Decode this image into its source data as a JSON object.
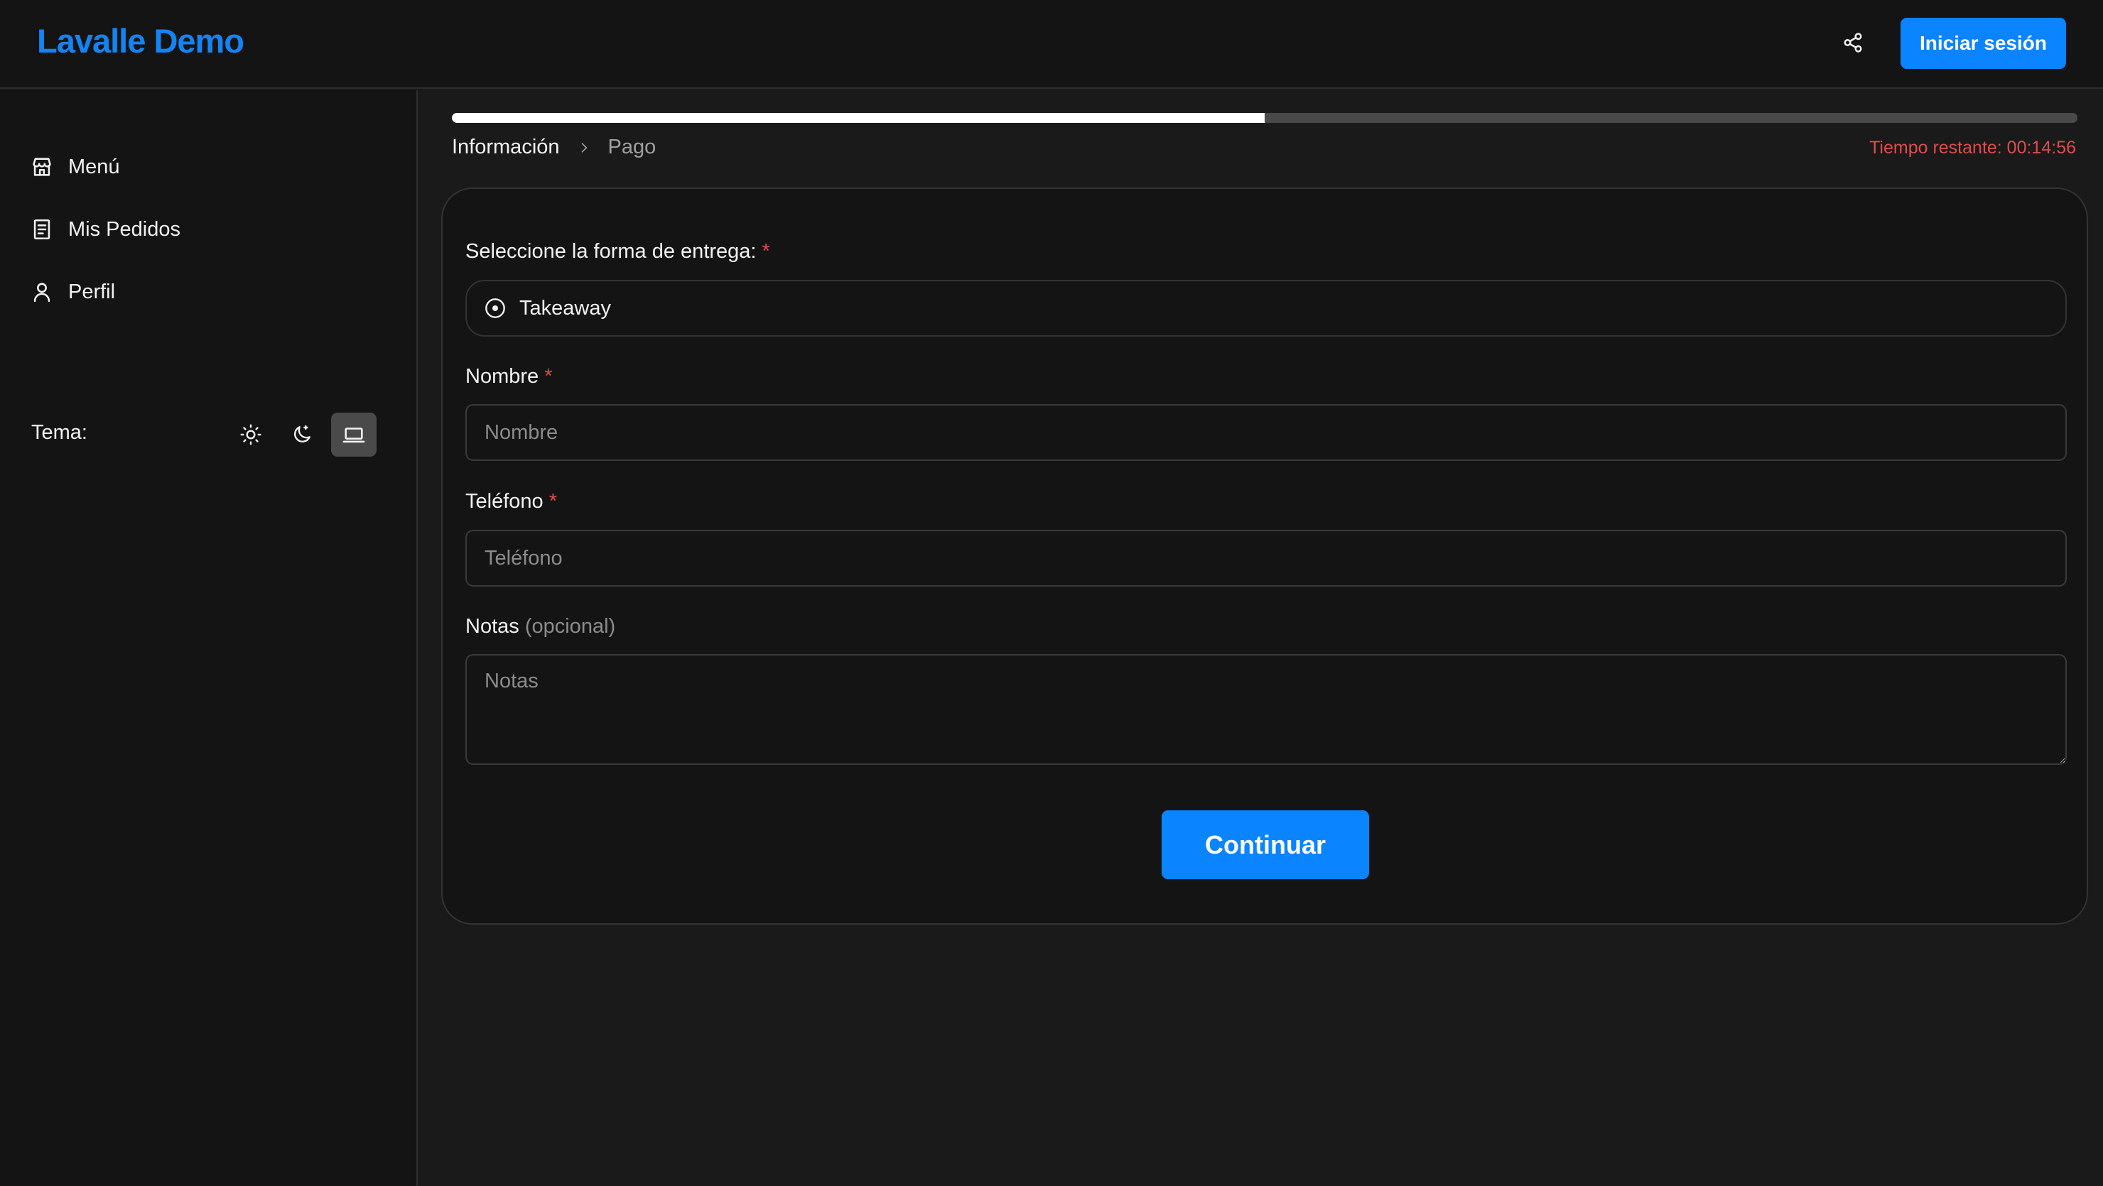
{
  "header": {
    "brand": "Lavalle Demo",
    "share_icon": "share-icon",
    "login_label": "Iniciar sesión"
  },
  "sidebar": {
    "items": [
      {
        "label": "Menú",
        "icon": "store-icon"
      },
      {
        "label": "Mis Pedidos",
        "icon": "receipt-icon"
      },
      {
        "label": "Perfil",
        "icon": "user-icon"
      }
    ],
    "theme_label": "Tema:",
    "theme_options": [
      "sun-icon",
      "moon-icon",
      "laptop-icon"
    ],
    "theme_selected": "laptop-icon"
  },
  "checkout": {
    "progress_fraction": 0.5,
    "steps": [
      "Información",
      "Pago"
    ],
    "timer": "Tiempo restante: 00:14:56"
  },
  "form": {
    "delivery_label": "Seleccione la forma de entrega:",
    "required_mark": "*",
    "delivery_option": "Takeaway",
    "name_label": "Nombre",
    "name_placeholder": "Nombre",
    "phone_label": "Teléfono",
    "phone_placeholder": "Teléfono",
    "notes_label": "Notas",
    "notes_optional": "(opcional)",
    "notes_placeholder": "Notas",
    "submit_label": "Continuar"
  },
  "colors": {
    "accent": "#0a84ff",
    "brand": "#1484f5",
    "required": "#e24b4b",
    "timer": "#e24b4b"
  }
}
